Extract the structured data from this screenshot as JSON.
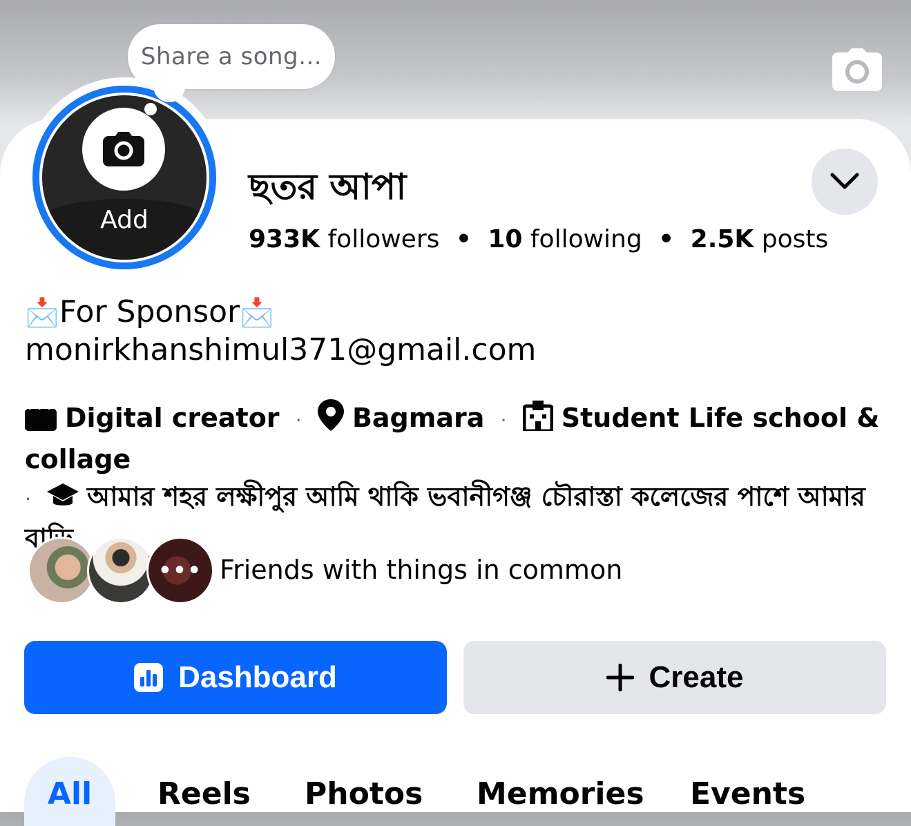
{
  "song_prompt": "Share a song...",
  "avatar": {
    "add_label": "Add"
  },
  "profile": {
    "name": "ছতর আপা"
  },
  "stats": {
    "followers_count": "933K",
    "followers_label": "followers",
    "following_count": "10",
    "following_label": "following",
    "posts_count": "2.5K",
    "posts_label": "posts",
    "separator": "•"
  },
  "bio": {
    "line1": "For Sponsor",
    "email": "monirkhanshimul371@gmail.com",
    "emoji": "📩"
  },
  "details": {
    "category": "Digital creator",
    "location": "Bagmara",
    "school": "Student Life school & collage",
    "about": "আমার শহর লক্ষীপুর আমি  থাকি ভবানীগঞ্জ চৌরাস্তা কলেজের পাশে আমার বাড়ি",
    "separator": "·"
  },
  "friends": {
    "text": "Friends with things in common",
    "more": "•••"
  },
  "actions": {
    "dashboard_label": "Dashboard",
    "create_label": "Create"
  },
  "tabs": [
    "All",
    "Reels",
    "Photos",
    "Memories",
    "Events"
  ],
  "colors": {
    "accent": "#0866ff",
    "ring": "#1877f2",
    "secondary_button": "#e4e6eb"
  },
  "icons": [
    "cover-camera-icon",
    "camera-icon",
    "chevron-down-icon",
    "clapperboard-icon",
    "location-pin-icon",
    "school-icon",
    "graduation-cap-icon",
    "dashboard-chart-icon",
    "plus-icon"
  ]
}
